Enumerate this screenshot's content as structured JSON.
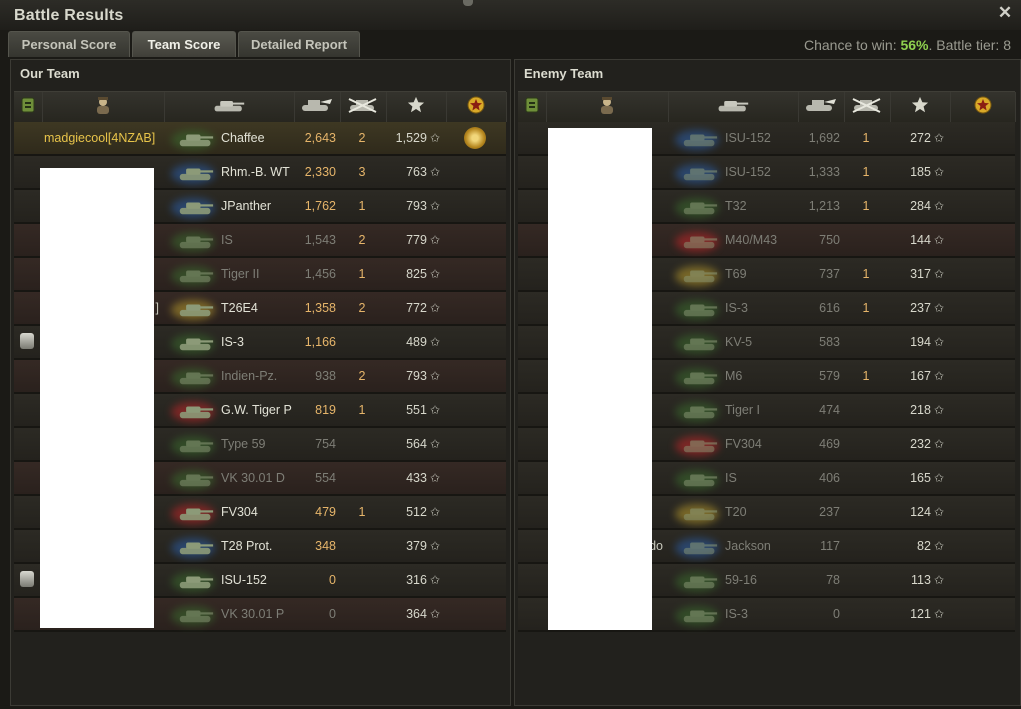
{
  "window": {
    "title": "Battle Results"
  },
  "tabs": [
    {
      "label": "Personal Score",
      "active": false
    },
    {
      "label": "Team Score",
      "active": true
    },
    {
      "label": "Detailed Report",
      "active": false
    }
  ],
  "battle_info": {
    "chance_label": "Chance to win: ",
    "chance_value": "56%",
    "tier_text": ". Battle tier: 8"
  },
  "our_team": {
    "title": "Our Team",
    "rows": [
      {
        "player": "madgiecool[4NZAB]",
        "vehicle": "Chaffee",
        "damage": "2,643",
        "kills": "2",
        "xp": "1,529",
        "alive": true,
        "me": true,
        "medal": true,
        "color": "#3b6a2e"
      },
      {
        "player": "",
        "vehicle": "Rhm.-B. WT",
        "damage": "2,330",
        "kills": "3",
        "xp": "763",
        "alive": true,
        "color": "#2c5fa8"
      },
      {
        "player": "",
        "vehicle": "JPanther",
        "damage": "1,762",
        "kills": "1",
        "xp": "793",
        "alive": true,
        "color": "#2c5fa8"
      },
      {
        "player": "",
        "vehicle": "IS",
        "damage": "1,543",
        "kills": "2",
        "xp": "779",
        "alive": false,
        "tk": true,
        "color": "#3b6a2e"
      },
      {
        "player": "",
        "vehicle": "Tiger II",
        "damage": "1,456",
        "kills": "1",
        "xp": "825",
        "alive": false,
        "tk": true,
        "color": "#3b6a2e"
      },
      {
        "player": "]",
        "vehicle": "T26E4",
        "damage": "1,358",
        "kills": "2",
        "xp": "772",
        "alive": true,
        "tk": true,
        "color": "#b89b2e"
      },
      {
        "player": "",
        "vehicle": "IS-3",
        "damage": "1,166",
        "kills": "",
        "xp": "489",
        "alive": true,
        "pin": true,
        "color": "#3b6a2e"
      },
      {
        "player": "",
        "vehicle": "Indien-Pz.",
        "damage": "938",
        "kills": "2",
        "xp": "793",
        "alive": false,
        "tk": true,
        "color": "#3b6a2e"
      },
      {
        "player": "",
        "vehicle": "G.W. Tiger P",
        "damage": "819",
        "kills": "1",
        "xp": "551",
        "alive": true,
        "color": "#c0282a"
      },
      {
        "player": "",
        "vehicle": "Type 59",
        "damage": "754",
        "kills": "",
        "xp": "564",
        "alive": false,
        "color": "#3b6a2e"
      },
      {
        "player": "",
        "vehicle": "VK 30.01 D",
        "damage": "554",
        "kills": "",
        "xp": "433",
        "alive": false,
        "tk": true,
        "color": "#3b6a2e"
      },
      {
        "player": "",
        "vehicle": "FV304",
        "damage": "479",
        "kills": "1",
        "xp": "512",
        "alive": true,
        "color": "#c0282a"
      },
      {
        "player": "",
        "vehicle": "T28 Prot.",
        "damage": "348",
        "kills": "",
        "xp": "379",
        "alive": true,
        "color": "#2c5fa8"
      },
      {
        "player": "",
        "vehicle": "ISU-152",
        "damage": "0",
        "kills": "",
        "xp": "316",
        "alive": true,
        "pin": true,
        "color": "#3b6a2e"
      },
      {
        "player": "",
        "vehicle": "VK 30.01 P",
        "damage": "0",
        "kills": "",
        "xp": "364",
        "alive": false,
        "tk": true,
        "color": "#3b6a2e"
      }
    ]
  },
  "enemy_team": {
    "title": "Enemy Team",
    "rows": [
      {
        "player": "",
        "vehicle": "ISU-152",
        "damage": "1,692",
        "kills": "1",
        "xp": "272",
        "alive": false,
        "color": "#2c5fa8"
      },
      {
        "player": "",
        "vehicle": "ISU-152",
        "damage": "1,333",
        "kills": "1",
        "xp": "185",
        "alive": false,
        "color": "#2c5fa8"
      },
      {
        "player": "",
        "vehicle": "T32",
        "damage": "1,213",
        "kills": "1",
        "xp": "284",
        "alive": false,
        "color": "#3b6a2e"
      },
      {
        "player": "",
        "vehicle": "M40/M43",
        "damage": "750",
        "kills": "",
        "xp": "144",
        "alive": false,
        "tk": true,
        "color": "#c0282a"
      },
      {
        "player": "",
        "vehicle": "T69",
        "damage": "737",
        "kills": "1",
        "xp": "317",
        "alive": false,
        "color": "#b89b2e"
      },
      {
        "player": "",
        "vehicle": "IS-3",
        "damage": "616",
        "kills": "1",
        "xp": "237",
        "alive": false,
        "color": "#3b6a2e"
      },
      {
        "player": "",
        "vehicle": "KV-5",
        "damage": "583",
        "kills": "",
        "xp": "194",
        "alive": false,
        "color": "#3b6a2e"
      },
      {
        "player": "",
        "vehicle": "M6",
        "damage": "579",
        "kills": "1",
        "xp": "167",
        "alive": false,
        "color": "#3b6a2e"
      },
      {
        "player": "",
        "vehicle": "Tiger I",
        "damage": "474",
        "kills": "",
        "xp": "218",
        "alive": false,
        "color": "#3b6a2e"
      },
      {
        "player": "",
        "vehicle": "FV304",
        "damage": "469",
        "kills": "",
        "xp": "232",
        "alive": false,
        "color": "#c0282a"
      },
      {
        "player": "",
        "vehicle": "IS",
        "damage": "406",
        "kills": "",
        "xp": "165",
        "alive": false,
        "color": "#3b6a2e"
      },
      {
        "player": "",
        "vehicle": "T20",
        "damage": "237",
        "kills": "",
        "xp": "124",
        "alive": false,
        "color": "#b89b2e"
      },
      {
        "player": "ado",
        "vehicle": "Jackson",
        "damage": "117",
        "kills": "",
        "xp": "82",
        "alive": false,
        "color": "#2c5fa8"
      },
      {
        "player": "",
        "vehicle": "59-16",
        "damage": "78",
        "kills": "",
        "xp": "113",
        "alive": false,
        "color": "#3b6a2e"
      },
      {
        "player": "",
        "vehicle": "IS-3",
        "damage": "0",
        "kills": "",
        "xp": "121",
        "alive": false,
        "color": "#3b6a2e"
      }
    ]
  },
  "icons": {
    "close": "close-icon",
    "squad": "squad-icon",
    "commander": "commander-icon",
    "tank": "tank-icon",
    "damage": "damage-icon",
    "kills": "kills-icon",
    "xp": "star-icon",
    "medal": "medal-icon"
  }
}
